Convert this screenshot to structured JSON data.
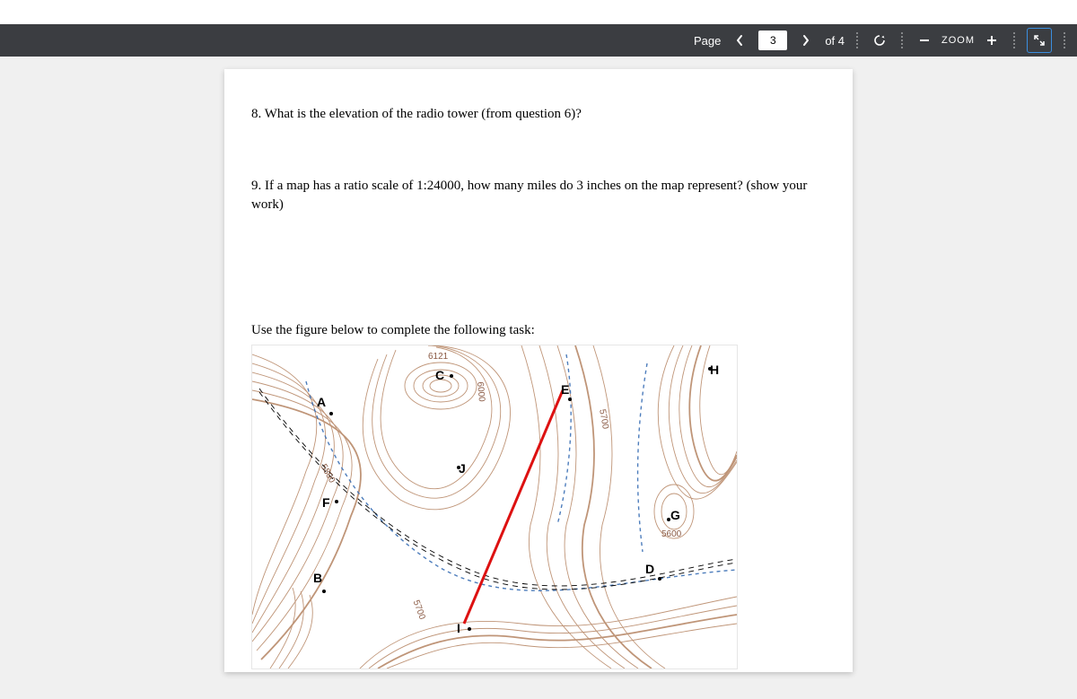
{
  "toolbar": {
    "page_label": "Page",
    "current_page": "3",
    "of_label": "of 4",
    "zoom_label": "ZOOM"
  },
  "doc": {
    "q8": "8. What is the elevation of the radio tower (from question 6)?",
    "q9": "9. If a map has a ratio scale of 1:24000, how many miles do 3 inches on the map represent? (show your work)",
    "instruction": "Use the figure below to complete the following task:"
  },
  "map": {
    "labels": {
      "A": "A",
      "B": "B",
      "C": "C",
      "D": "D",
      "E": "E",
      "F": "F",
      "G": "G",
      "H": "H",
      "I": "I",
      "J": "J"
    },
    "elev": {
      "6121": "6121",
      "e5800": "5800",
      "e6000": "6000",
      "e5700a": "5700",
      "e5600": "5600",
      "e5700b": "5700",
      "e5700c": "5700"
    }
  }
}
